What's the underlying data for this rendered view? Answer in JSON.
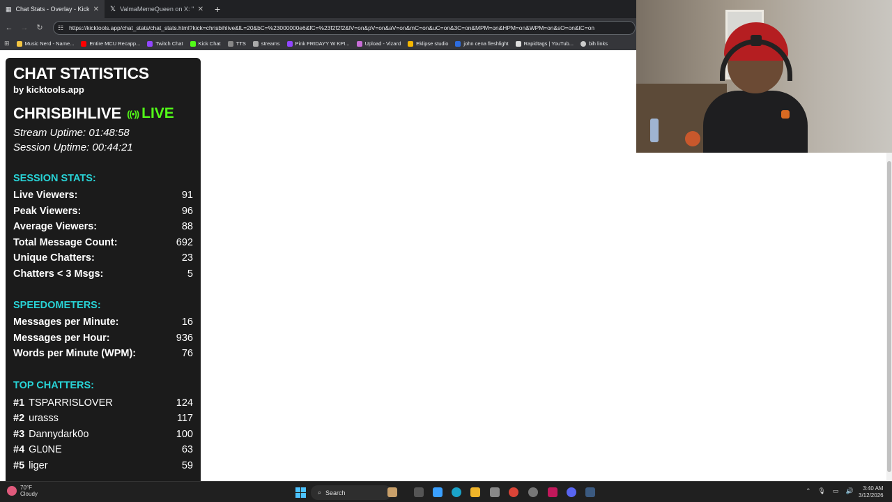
{
  "browser": {
    "tabs": [
      {
        "title": "Chat Stats - Overlay - KickTools",
        "active": true
      },
      {
        "title": "ValmaMemeQueen on X: \"http",
        "active": false
      }
    ],
    "url": "https://kicktools.app/chat_stats/chat_stats.html?kick=chrisbihlive&lL=20&bC=%23000000e6&fC=%23f2f2f2&lV=on&pV=on&aV=on&mC=on&uC=on&3C=on&MPM=on&HPM=on&WPM=on&sO=on&tC=on",
    "bookmarks": [
      {
        "label": "Music Nerd - Name...",
        "color": "#f4c542"
      },
      {
        "label": "Entire MCU Recapp...",
        "color": "#ff0000"
      },
      {
        "label": "Twitch Chat",
        "color": "#9146ff"
      },
      {
        "label": "Kick Chat",
        "color": "#53fc18"
      },
      {
        "label": "TTS",
        "color": "#888888"
      },
      {
        "label": "streams",
        "color": "#aaaaaa"
      },
      {
        "label": "Pink FRIDAYY W KPI...",
        "color": "#9146ff"
      },
      {
        "label": "Upload - Vizard",
        "color": "#c86dd7"
      },
      {
        "label": "Eklipse studio",
        "color": "#f5b700"
      },
      {
        "label": "john cena fleshlight",
        "color": "#2d6cdf"
      },
      {
        "label": "Rapidtags | YouTub...",
        "color": "#dddddd"
      },
      {
        "label": "bih links",
        "color": "#cccccc"
      }
    ]
  },
  "overlay": {
    "title": "CHAT STATISTICS",
    "byline": "by kicktools.app",
    "channel": "CHRISBIHLIVE",
    "live_label": "LIVE",
    "live_color": "#53fc18",
    "accent_color": "#28d3d6",
    "stream_uptime": "Stream Uptime: 01:48:58",
    "session_uptime": "Session Uptime: 00:44:21",
    "session_title": "SESSION STATS:",
    "session_stats": [
      {
        "label": "Live Viewers:",
        "value": "91"
      },
      {
        "label": "Peak Viewers:",
        "value": "96"
      },
      {
        "label": "Average Viewers:",
        "value": "88"
      },
      {
        "label": "Total Message Count:",
        "value": "692"
      },
      {
        "label": "Unique Chatters:",
        "value": "23"
      },
      {
        "label": "Chatters < 3 Msgs:",
        "value": "5"
      }
    ],
    "speed_title": "SPEEDOMETERS:",
    "speedometers": [
      {
        "label": "Messages per Minute:",
        "value": "16"
      },
      {
        "label": "Messages per Hour:",
        "value": "936"
      },
      {
        "label": "Words per Minute (WPM):",
        "value": "76"
      }
    ],
    "top_title": "TOP CHATTERS:",
    "top_chatters": [
      {
        "rank": "#1",
        "name": "TSPARRISLOVER",
        "count": "124"
      },
      {
        "rank": "#2",
        "name": "urasss",
        "count": "117"
      },
      {
        "rank": "#3",
        "name": "Dannydark0o",
        "count": "100"
      },
      {
        "rank": "#4",
        "name": "GL0NE",
        "count": "63"
      },
      {
        "rank": "#5",
        "name": "liger",
        "count": "59"
      }
    ]
  },
  "taskbar": {
    "weather_temp": "70°F",
    "weather_desc": "Cloudy",
    "search_label": "Search",
    "time": "3:40 AM",
    "date": "3/12/2026"
  }
}
